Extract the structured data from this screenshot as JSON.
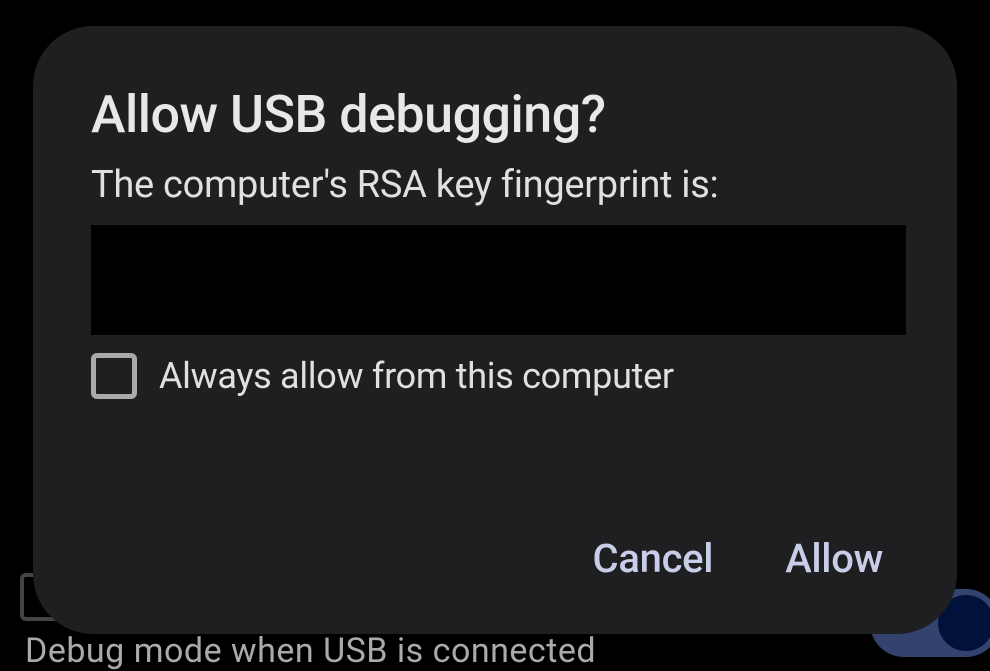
{
  "background": {
    "subtitle": "Debug mode when USB is connected"
  },
  "dialog": {
    "title": "Allow USB debugging?",
    "message": "The computer's RSA key fingerprint is:",
    "checkbox_label": "Always allow from this computer",
    "buttons": {
      "cancel": "Cancel",
      "allow": "Allow"
    }
  }
}
